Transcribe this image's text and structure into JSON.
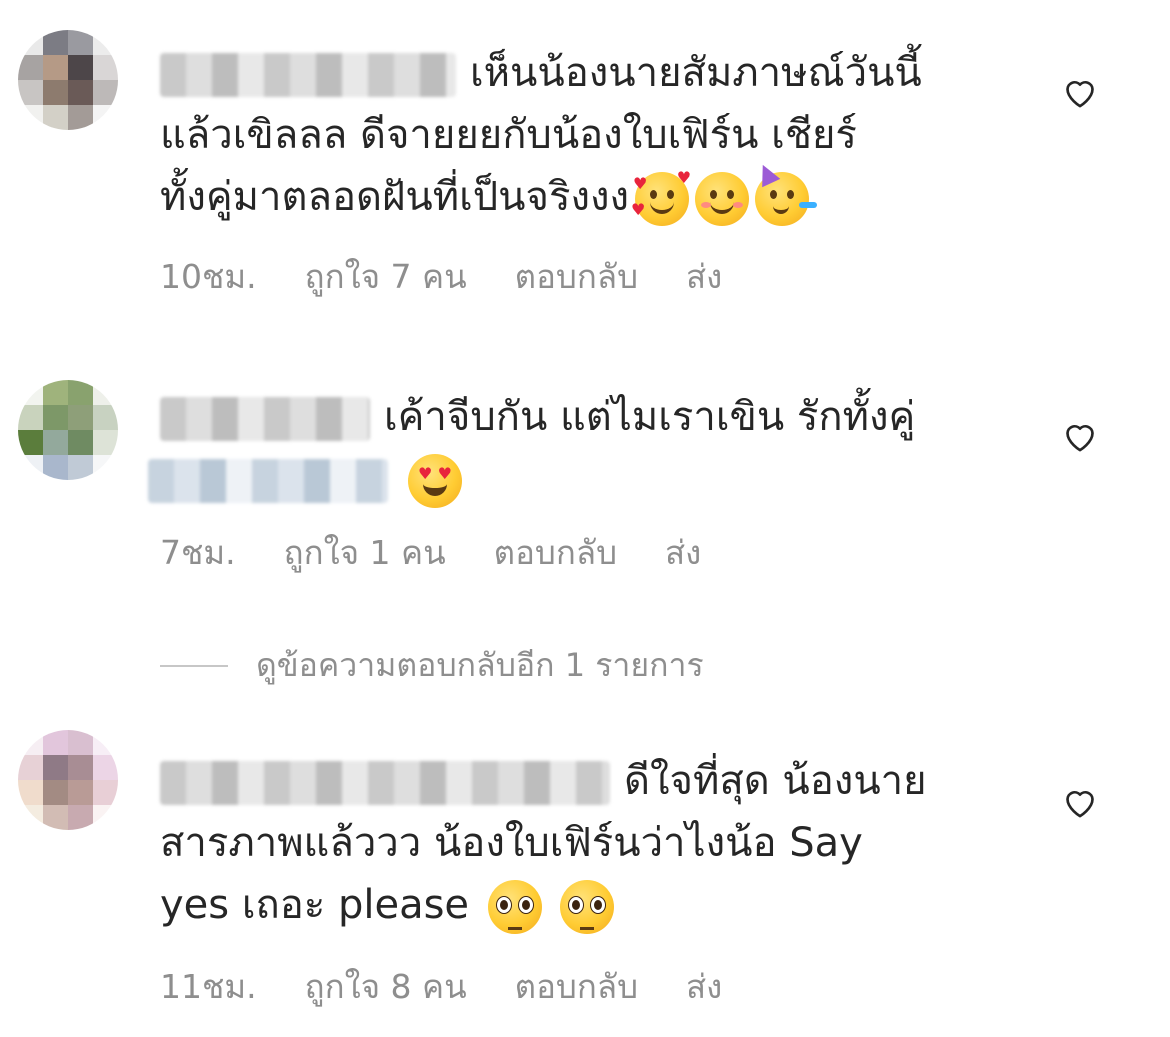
{
  "comments": [
    {
      "lines": [
        "เห็นน้องนายสัมภาษณ์วันนี้",
        "แล้วเขิลลล ดีจายยยกับน้องใบเฟิร์น เชียร์",
        "ทั้งคู่มาตลอดฝันที่เป็นจริงงง"
      ],
      "emojis": [
        "smiling-face-with-hearts-emoji",
        "smiling-face-emoji",
        "partying-face-emoji"
      ],
      "time": "10ชม.",
      "likes": "ถูกใจ 7 คน",
      "reply": "ตอบกลับ",
      "send": "ส่ง"
    },
    {
      "lines": [
        "เค้าจีบกัน แต่ไมเราเขิน รักทั้งคู่"
      ],
      "emojis": [
        "heart-eyes-emoji"
      ],
      "time": "7ชม.",
      "likes": "ถูกใจ 1 คน",
      "reply": "ตอบกลับ",
      "send": "ส่ง"
    },
    {
      "lines": [
        "ดีใจที่สุด น้องนาย",
        "สารภาพแล้ววว น้องใบเฟิร์นว่าไงน้อ Say",
        "yes เถอะ please"
      ],
      "emojis": [
        "pleading-face-emoji",
        "pleading-face-emoji"
      ],
      "time": "11ชม.",
      "likes": "ถูกใจ 8 คน",
      "reply": "ตอบกลับ",
      "send": "ส่ง"
    }
  ],
  "view_replies": "ดูข้อความตอบกลับอีก 1 รายการ",
  "icons": {
    "like": "heart-outline-icon"
  },
  "colors": {
    "text": "#262626",
    "secondary": "#8e8e8e",
    "background": "#ffffff"
  }
}
